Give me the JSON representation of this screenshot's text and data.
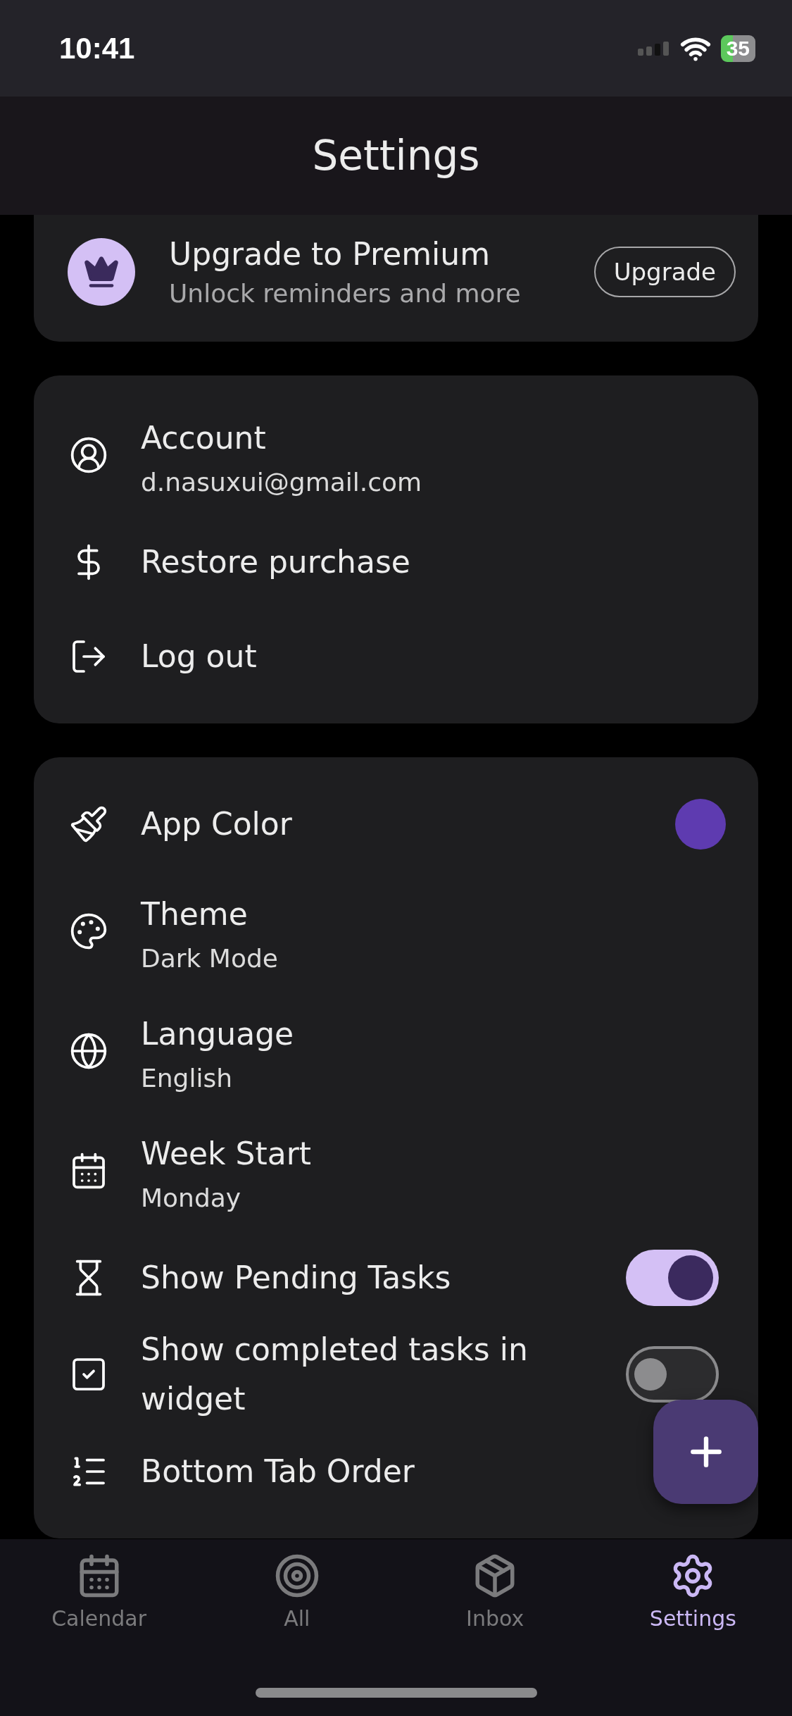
{
  "status_bar": {
    "time": "10:41",
    "battery": "35"
  },
  "header": {
    "title": "Settings"
  },
  "premium": {
    "title": "Upgrade to Premium",
    "subtitle": "Unlock reminders and more",
    "button": "Upgrade"
  },
  "account_section": [
    {
      "kind": "value",
      "label": "Account",
      "value": "d.nasuxui@gmail.com"
    },
    {
      "kind": "plain",
      "label": "Restore purchase"
    },
    {
      "kind": "plain",
      "label": "Log out"
    }
  ],
  "preferences": [
    {
      "kind": "color",
      "label": "App Color",
      "color": "#5e3bb0"
    },
    {
      "kind": "value",
      "label": "Theme",
      "value": "Dark Mode"
    },
    {
      "kind": "value",
      "label": "Language",
      "value": "English"
    },
    {
      "kind": "value",
      "label": "Week Start",
      "value": "Monday"
    },
    {
      "kind": "toggle",
      "label": "Show Pending Tasks",
      "on": true
    },
    {
      "kind": "toggle",
      "label": "Show completed tasks in widget",
      "on": false
    },
    {
      "kind": "plain",
      "label": "Bottom Tab Order"
    }
  ],
  "tabs": [
    {
      "label": "Calendar",
      "selected": false
    },
    {
      "label": "All",
      "selected": false
    },
    {
      "label": "Inbox",
      "selected": false
    },
    {
      "label": "Settings",
      "selected": true
    }
  ]
}
